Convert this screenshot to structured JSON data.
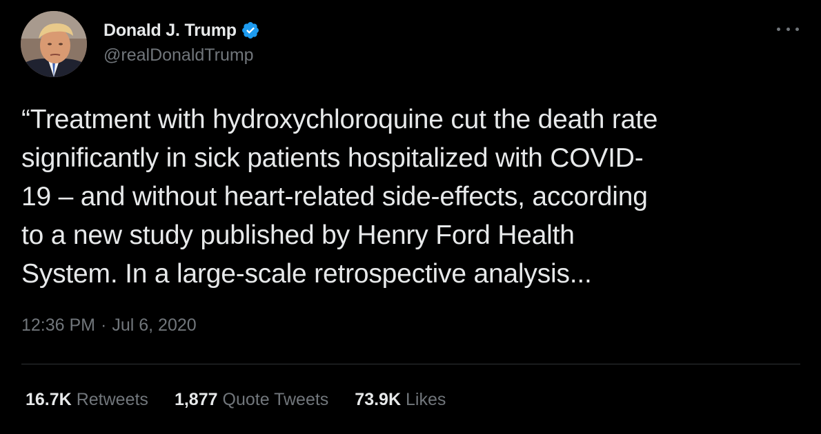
{
  "author": {
    "display_name": "Donald J. Trump",
    "handle": "@realDonaldTrump",
    "verified_icon": "verified-badge-icon",
    "verified_color": "#1d9bf0"
  },
  "tweet": {
    "lines": [
      "“Treatment with hydroxychloroquine cut the death rate",
      "significantly in sick patients hospitalized with COVID-",
      "19 – and without heart-related side-effects, according",
      "to a new study published by Henry Ford Health",
      "System. In a large-scale retrospective analysis..."
    ],
    "time": "12:36 PM",
    "separator": "·",
    "date": "Jul 6, 2020"
  },
  "stats": {
    "retweets_count": "16.7K",
    "retweets_label": "Retweets",
    "quotes_count": "1,877",
    "quotes_label": "Quote Tweets",
    "likes_count": "73.9K",
    "likes_label": "Likes"
  },
  "theme": {
    "background": "#000000",
    "primary_text": "#e7e9ea",
    "secondary_text": "#71767b",
    "divider": "#2f3336"
  }
}
